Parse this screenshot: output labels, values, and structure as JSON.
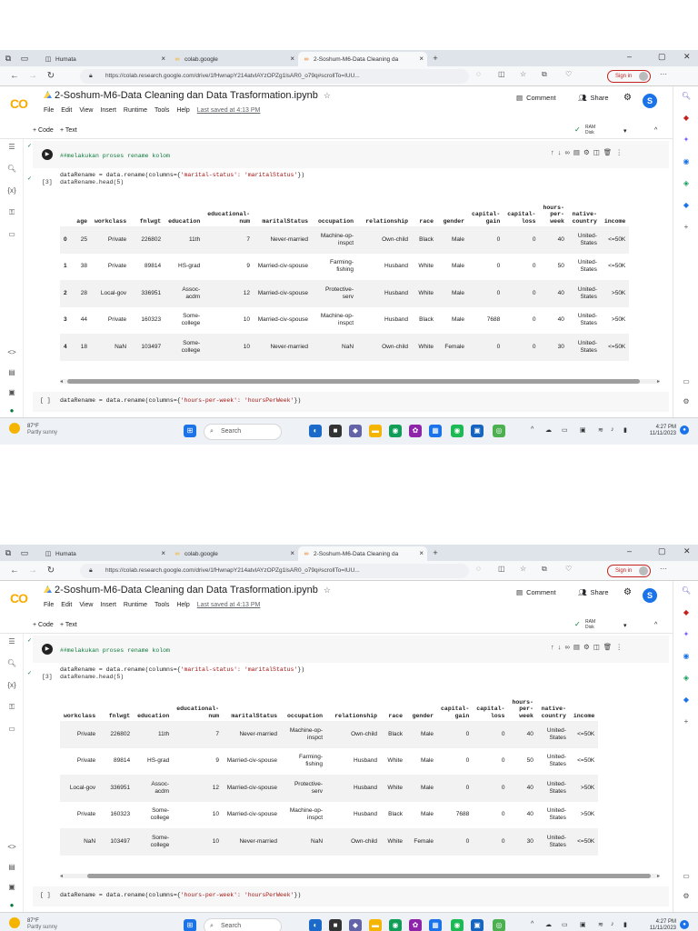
{
  "browser": {
    "tabs": [
      {
        "label": "Humata",
        "icon": "humata-icon",
        "active": false
      },
      {
        "label": "colab.google",
        "icon": "colab-icon",
        "active": false
      },
      {
        "label": "2-Soshum-M6-Data Cleaning da",
        "icon": "colab-icon",
        "active": true
      }
    ],
    "url": "https://colab.research.google.com/drive/1fHwnapY214atvlAYzOPZg1lsAR0_o79q#scrollTo=IUU...",
    "sign_in": "Sign in"
  },
  "colab": {
    "logo": "CO",
    "title": "2-Soshum-M6-Data Cleaning dan Data Trasformation.ipynb",
    "menu": [
      "File",
      "Edit",
      "View",
      "Insert",
      "Runtime",
      "Tools",
      "Help"
    ],
    "last_saved": "Last saved at 4:13 PM",
    "comment": "Comment",
    "share": "Share",
    "avatar": "S",
    "add_code": "+ Code",
    "add_text": "+ Text",
    "ram_label": "RAM",
    "disk_label": "Disk"
  },
  "cells": {
    "cell1_comment": "##melakukan proses rename kolom",
    "cell1_code_a": "dataRename = data.rename(columns={",
    "cell1_code_str": "'marital-status': 'maritalStatus'",
    "cell1_code_b": "})",
    "cell2_count": "[3]",
    "cell2_code": "dataRename.head(5)",
    "cell3_count": "[ ]",
    "cell3_code_a": "dataRename = data.rename(columns={",
    "cell3_code_str": "'hours-per-week': 'hoursPerWeek'",
    "cell3_code_b": "})"
  },
  "dataframe": {
    "columns": [
      "",
      "age",
      "workclass",
      "fnlwgt",
      "education",
      "educational-num",
      "maritalStatus",
      "occupation",
      "relationship",
      "race",
      "gender",
      "capital-gain",
      "capital-loss",
      "hours-per-week",
      "native-country",
      "income"
    ],
    "rows": [
      [
        "0",
        "25",
        "Private",
        "226802",
        "11th",
        "7",
        "Never-married",
        "Machine-op-inspct",
        "Own-child",
        "Black",
        "Male",
        "0",
        "0",
        "40",
        "United-States",
        "<=50K"
      ],
      [
        "1",
        "38",
        "Private",
        "89814",
        "HS-grad",
        "9",
        "Married-civ-spouse",
        "Farming-fishing",
        "Husband",
        "White",
        "Male",
        "0",
        "0",
        "50",
        "United-States",
        "<=50K"
      ],
      [
        "2",
        "28",
        "Local-gov",
        "336951",
        "Assoc-acdm",
        "12",
        "Married-civ-spouse",
        "Protective-serv",
        "Husband",
        "White",
        "Male",
        "0",
        "0",
        "40",
        "United-States",
        ">50K"
      ],
      [
        "3",
        "44",
        "Private",
        "160323",
        "Some-college",
        "10",
        "Married-civ-spouse",
        "Machine-op-inspct",
        "Husband",
        "Black",
        "Male",
        "7688",
        "0",
        "40",
        "United-States",
        ">50K"
      ],
      [
        "4",
        "18",
        "NaN",
        "103497",
        "Some-college",
        "10",
        "Never-married",
        "NaN",
        "Own-child",
        "White",
        "Female",
        "0",
        "0",
        "30",
        "United-States",
        "<=50K"
      ]
    ]
  },
  "shot_top": {
    "truncated_column": "in"
  },
  "taskbar": {
    "temp": "87°F",
    "weather": "Partly sunny",
    "search": "Search",
    "time": "4:27 PM",
    "date": "11/11/2023"
  },
  "colors": {
    "colab_orange": "#e8710a",
    "colab_yellow": "#f9ab00",
    "avatar_blue": "#1a73e8",
    "signin_red": "#c5221f"
  }
}
